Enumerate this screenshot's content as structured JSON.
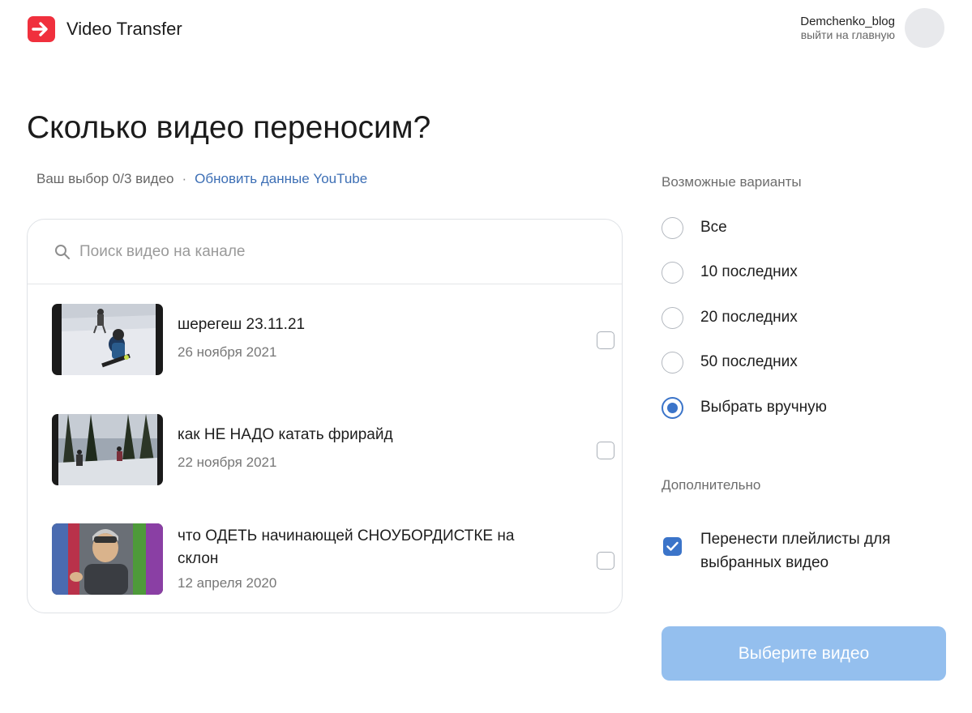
{
  "header": {
    "app_name": "Video Transfer",
    "user_name": "Demchenko_blog",
    "user_link": "выйти на главную"
  },
  "page": {
    "title": "Сколько видео переносим?",
    "selection_text": "Ваш выбор 0/3 видео",
    "refresh_link": "Обновить данные YouTube"
  },
  "search": {
    "placeholder": "Поиск видео на канале",
    "value": ""
  },
  "videos": [
    {
      "title": "шерегеш 23.11.21",
      "date": "26 ноября 2021",
      "checked": false
    },
    {
      "title": "как НЕ НАДО катать фрирайд",
      "date": "22 ноября 2021",
      "checked": false
    },
    {
      "title": "что ОДЕТЬ начинающей СНОУБОРДИСТКЕ на склон",
      "date": "12 апреля 2020",
      "checked": false
    }
  ],
  "options": {
    "label": "Возможные варианты",
    "items": [
      {
        "label": "Все",
        "selected": false
      },
      {
        "label": "10 последних",
        "selected": false
      },
      {
        "label": "20 последних",
        "selected": false
      },
      {
        "label": "50 последних",
        "selected": false
      },
      {
        "label": "Выбрать вручную",
        "selected": true
      }
    ]
  },
  "extra": {
    "label": "Дополнительно",
    "playlist_label": "Перенести плейлисты для выбранных видео",
    "playlist_checked": true
  },
  "cta_label": "Выберите видео",
  "colors": {
    "brand": "#f0303d",
    "accent": "#3b74c9",
    "link": "#3d6fb5",
    "cta_disabled": "#94bfee"
  }
}
